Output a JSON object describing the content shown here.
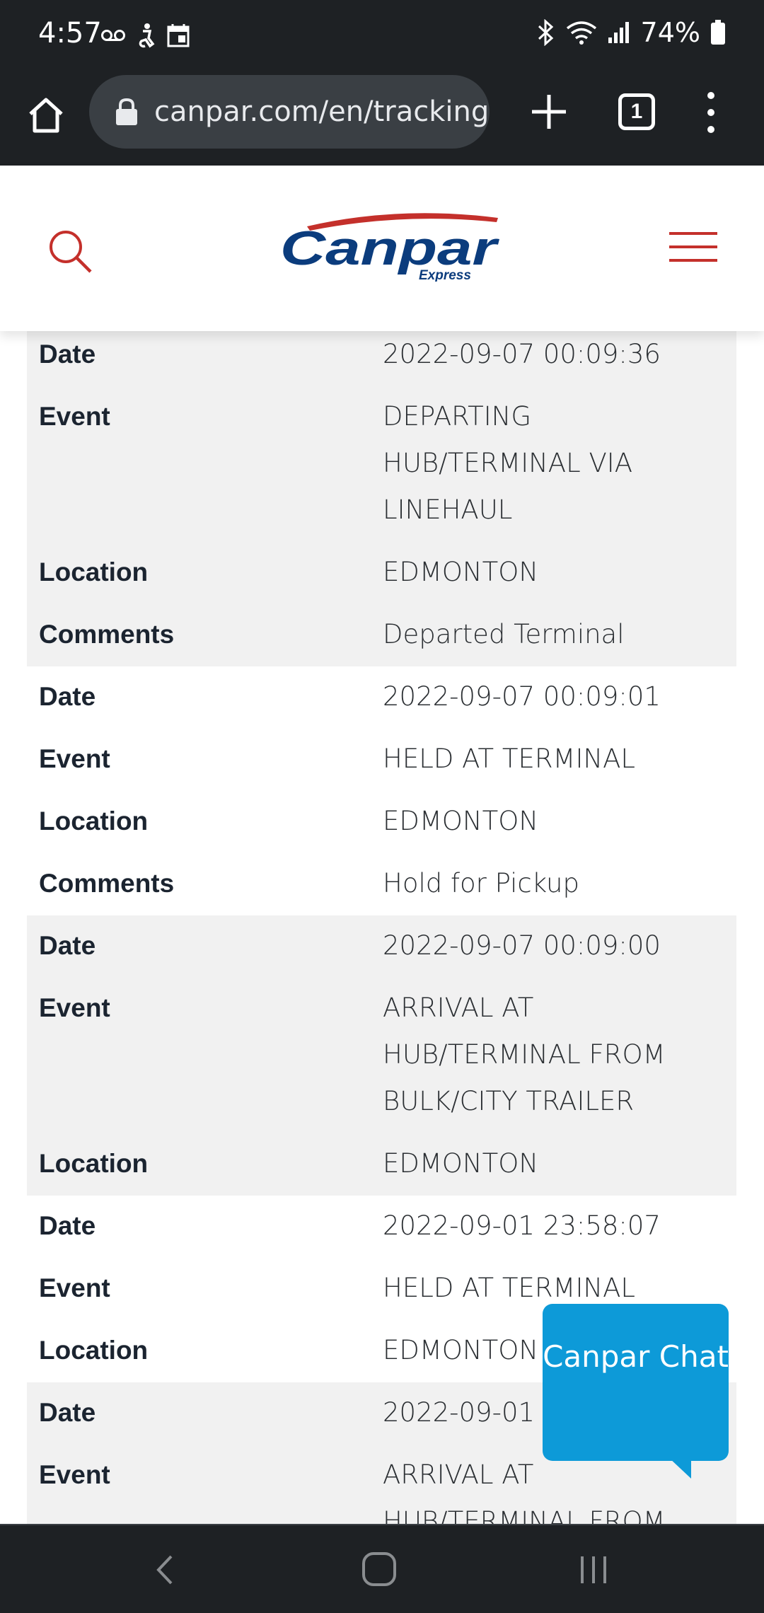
{
  "status_bar": {
    "time": "4:57",
    "battery": "74%",
    "icons_left": [
      "voicemail-icon",
      "accessibility-icon",
      "calendar-icon"
    ],
    "icons_right": [
      "bluetooth-icon",
      "wifi-icon",
      "signal-icon",
      "battery-icon"
    ]
  },
  "browser": {
    "url": "canpar.com/en/tracking",
    "tab_count": "1"
  },
  "site": {
    "logo_text": "Canpar",
    "logo_subtext": "Express",
    "brand_color": "#c4302b",
    "logo_blue": "#0b3c7d"
  },
  "tracking": {
    "groups": [
      {
        "shaded": true,
        "rows": [
          {
            "label": "Date",
            "value": "2022-09-07 00:09:36"
          },
          {
            "label": "Event",
            "value": "DEPARTING HUB/TERMINAL VIA LINEHAUL"
          },
          {
            "label": "Location",
            "value": "EDMONTON"
          },
          {
            "label": "Comments",
            "value": "Departed Terminal"
          }
        ]
      },
      {
        "shaded": false,
        "rows": [
          {
            "label": "Date",
            "value": "2022-09-07 00:09:01"
          },
          {
            "label": "Event",
            "value": "HELD AT TERMINAL"
          },
          {
            "label": "Location",
            "value": "EDMONTON"
          },
          {
            "label": "Comments",
            "value": "Hold for Pickup"
          }
        ]
      },
      {
        "shaded": true,
        "rows": [
          {
            "label": "Date",
            "value": "2022-09-07 00:09:00"
          },
          {
            "label": "Event",
            "value": "ARRIVAL AT HUB/TERMINAL FROM BULK/CITY TRAILER"
          },
          {
            "label": "Location",
            "value": "EDMONTON"
          }
        ]
      },
      {
        "shaded": false,
        "rows": [
          {
            "label": "Date",
            "value": "2022-09-01 23:58:07"
          },
          {
            "label": "Event",
            "value": "HELD AT TERMINAL"
          },
          {
            "label": "Location",
            "value": "EDMONTON"
          }
        ]
      },
      {
        "shaded": true,
        "rows": [
          {
            "label": "Date",
            "value": "2022-09-01 2"
          },
          {
            "label": "Event",
            "value": "ARRIVAL AT HUB/TERMINAL FROM"
          }
        ]
      }
    ]
  },
  "chat": {
    "label": "Canpar Chat"
  }
}
